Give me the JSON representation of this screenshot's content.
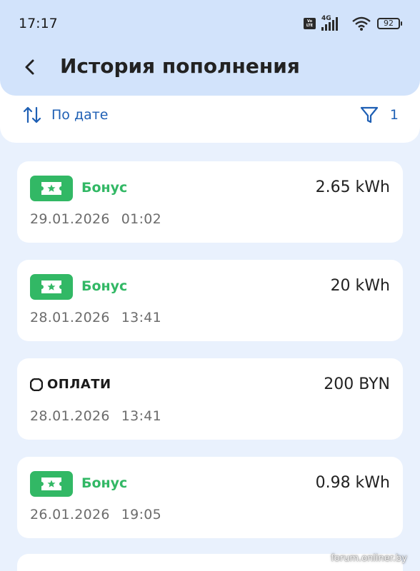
{
  "status_bar": {
    "time": "17:17",
    "network": "4G",
    "volte": "Vo LTE",
    "battery": "92"
  },
  "header": {
    "title": "История пополнения"
  },
  "toolbar": {
    "sort_label": "По дате",
    "filter_count": "1"
  },
  "colors": {
    "accent_blue": "#1e5fb4",
    "bonus_green": "#32b865",
    "header_bg": "#d2e3fb",
    "page_bg": "#e9f1fd"
  },
  "transactions": [
    {
      "source": "Бонус",
      "type": "bonus",
      "amount": "2.65 kWh",
      "date": "29.01.2026",
      "time": "01:02"
    },
    {
      "source": "Бонус",
      "type": "bonus",
      "amount": "20 kWh",
      "date": "28.01.2026",
      "time": "13:41"
    },
    {
      "source": "ОПЛАТИ",
      "type": "oplati",
      "amount": "200 BYN",
      "date": "28.01.2026",
      "time": "13:41"
    },
    {
      "source": "Бонус",
      "type": "bonus",
      "amount": "0.98 kWh",
      "date": "26.01.2026",
      "time": "19:05"
    }
  ],
  "watermark": "forum.onliner.by"
}
